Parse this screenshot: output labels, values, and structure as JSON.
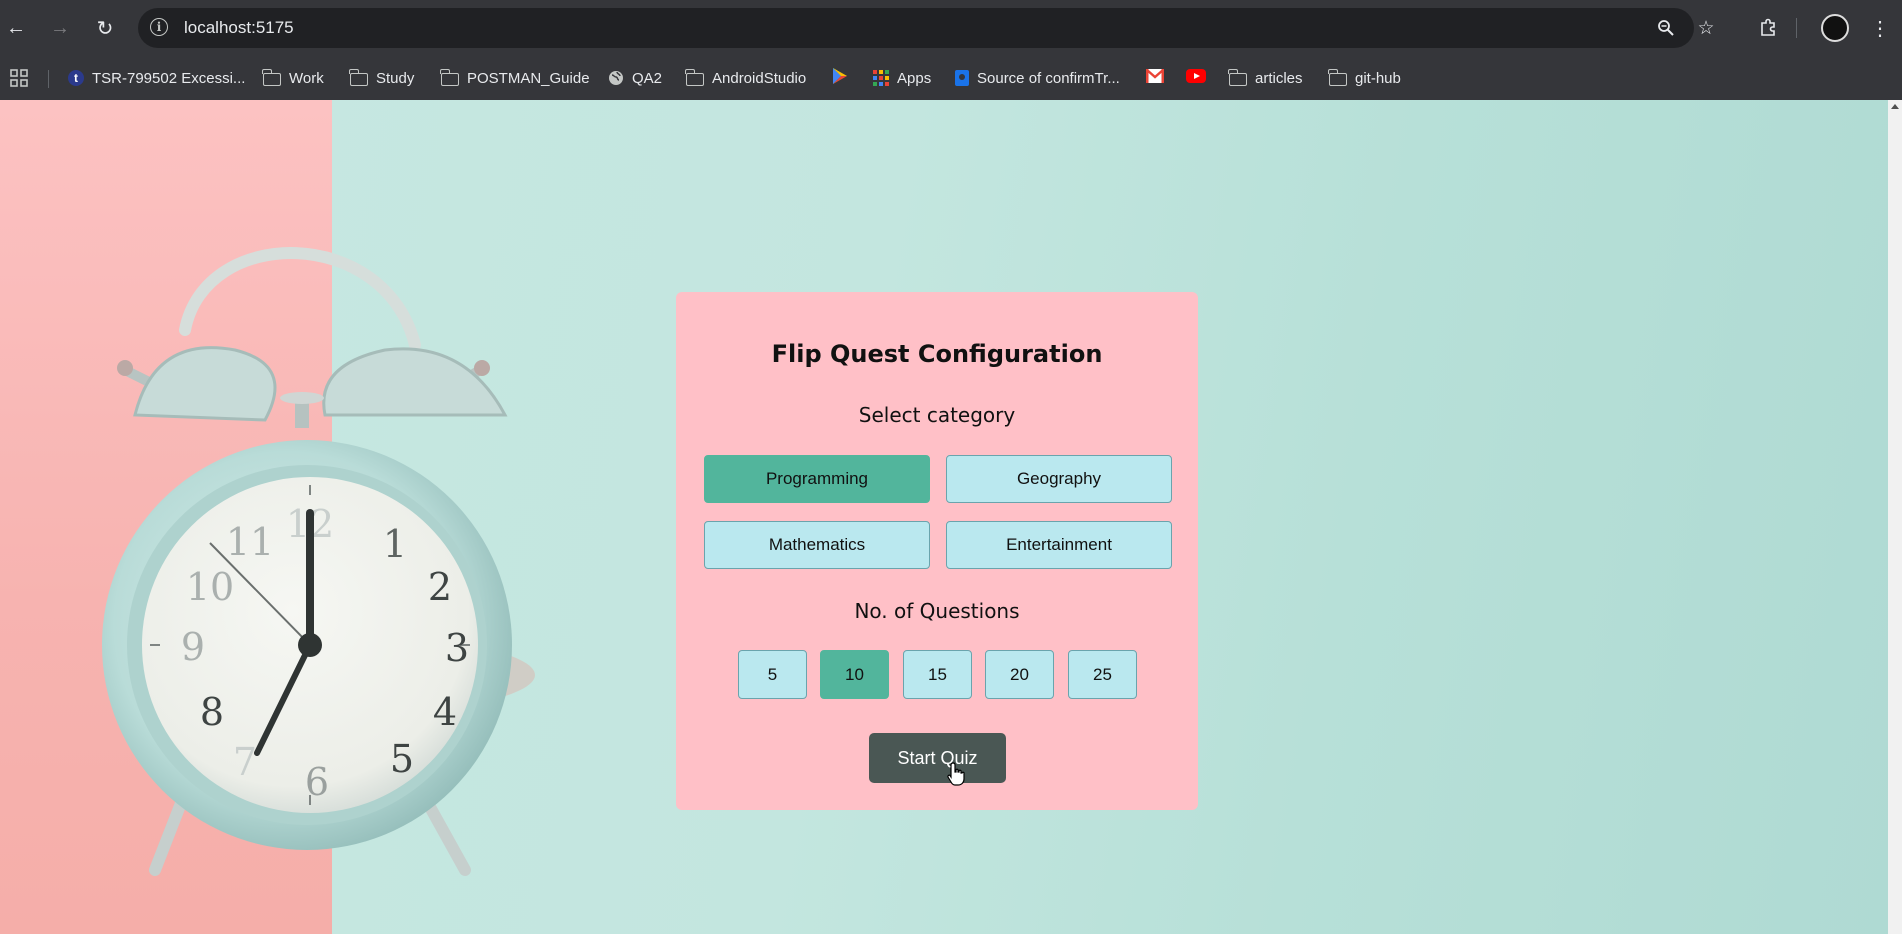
{
  "browser": {
    "url": "localhost:5175",
    "bookmarks": [
      {
        "label": "TSR-799502 Excessi...",
        "icon": "tumblr-icon"
      },
      {
        "label": "Work",
        "icon": "folder-icon"
      },
      {
        "label": "Study",
        "icon": "folder-icon"
      },
      {
        "label": "POSTMAN_Guide",
        "icon": "folder-icon"
      },
      {
        "label": "QA2",
        "icon": "globe-icon"
      },
      {
        "label": "AndroidStudio",
        "icon": "folder-icon"
      },
      {
        "label": "",
        "icon": "play-store-icon"
      },
      {
        "label": "Apps",
        "icon": "apps-grid-icon"
      },
      {
        "label": "Source of confirmTr...",
        "icon": "bookmark-site-icon"
      },
      {
        "label": "",
        "icon": "gmail-icon"
      },
      {
        "label": "",
        "icon": "youtube-icon"
      },
      {
        "label": "articles",
        "icon": "folder-icon"
      },
      {
        "label": "git-hub",
        "icon": "folder-icon"
      }
    ]
  },
  "quiz": {
    "title": "Flip Quest Configuration",
    "category_heading": "Select category",
    "categories": [
      {
        "label": "Programming",
        "selected": true
      },
      {
        "label": "Geography",
        "selected": false
      },
      {
        "label": "Mathematics",
        "selected": false
      },
      {
        "label": "Entertainment",
        "selected": false
      }
    ],
    "questions_heading": "No. of Questions",
    "question_counts": [
      {
        "label": "5",
        "selected": false
      },
      {
        "label": "10",
        "selected": true
      },
      {
        "label": "15",
        "selected": false
      },
      {
        "label": "20",
        "selected": false
      },
      {
        "label": "25",
        "selected": false
      }
    ],
    "start_label": "Start Quiz"
  },
  "colors": {
    "card": "#ffc0c7",
    "selected": "#52b59c",
    "unselected": "#bae8ef",
    "start_button": "#4a5754",
    "background_mint": "#c3e6df",
    "background_pink": "#fcc2c2"
  }
}
